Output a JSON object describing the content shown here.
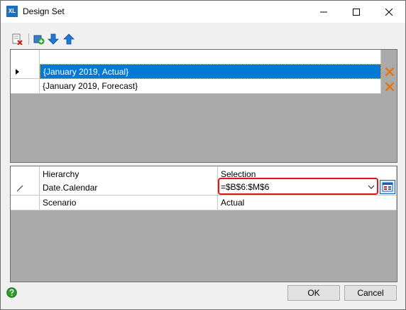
{
  "window": {
    "title": "Design Set",
    "icon_text": "XL"
  },
  "top_grid": {
    "rows": [
      {
        "value": "{January 2019, Actual}",
        "selected": true
      },
      {
        "value": "{January 2019, Forecast}",
        "selected": false
      }
    ]
  },
  "bottom_grid": {
    "headers": {
      "hierarchy": "Hierarchy",
      "selection": "Selection"
    },
    "rows": [
      {
        "hierarchy": "Date.Calendar",
        "selection": "=$B$6:$M$6"
      },
      {
        "hierarchy": "Scenario",
        "selection": "Actual"
      }
    ]
  },
  "buttons": {
    "ok": "OK",
    "cancel": "Cancel"
  },
  "colors": {
    "selection": "#0078d7",
    "highlight_border": "#e0141e",
    "delete_icon": "#e8730c"
  },
  "icons": [
    "app-icon",
    "minimize-icon",
    "maximize-icon",
    "close-icon",
    "clear-icon",
    "add-icon",
    "move-down-icon",
    "move-up-icon",
    "delete-icon",
    "pencil-icon",
    "picker-icon",
    "help-icon"
  ]
}
